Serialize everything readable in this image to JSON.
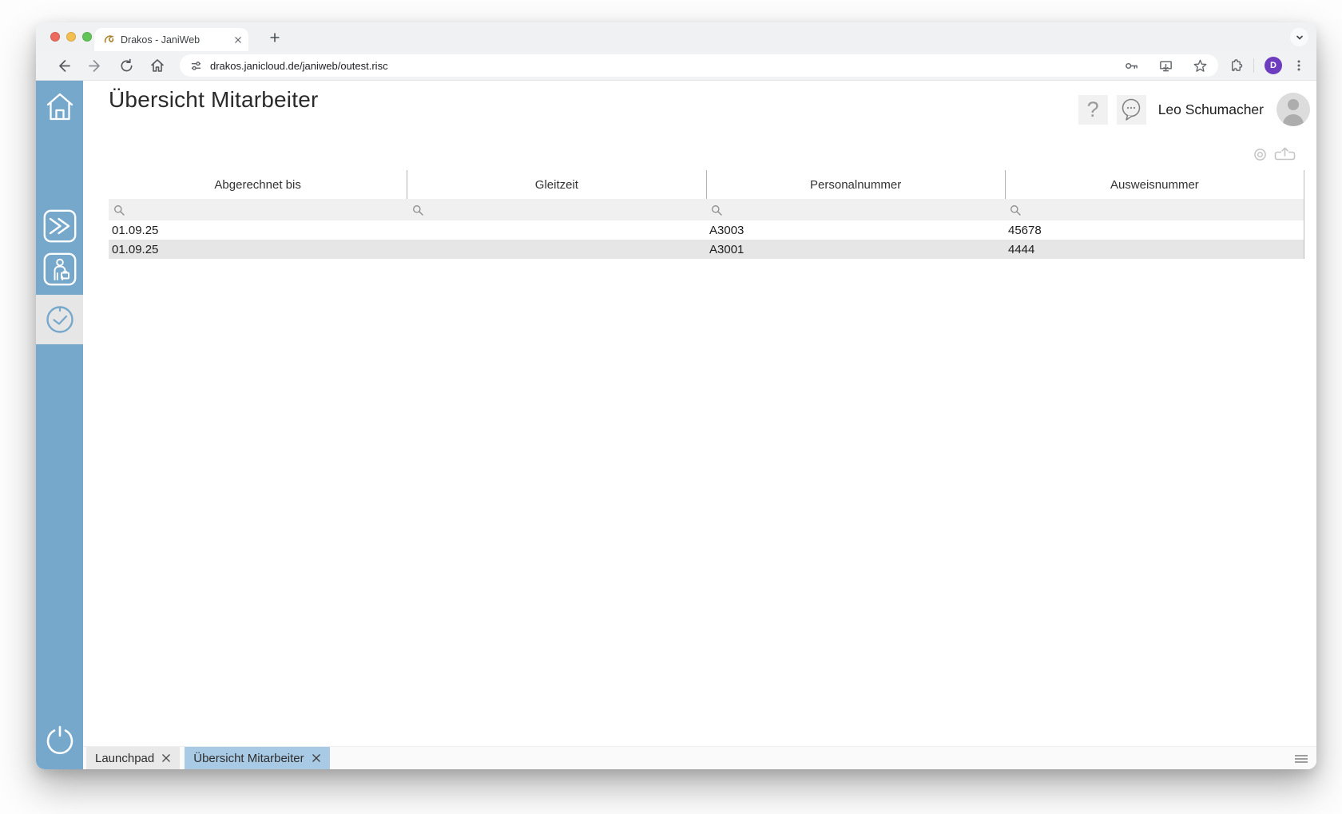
{
  "browser": {
    "tab_title": "Drakos - JaniWeb",
    "url": "drakos.janicloud.de/janiweb/outest.risc",
    "profile_initial": "D"
  },
  "header": {
    "title": "Übersicht Mitarbeiter",
    "help_label": "?",
    "user_name": "Leo Schumacher"
  },
  "table": {
    "columns": [
      "Abgerechnet bis",
      "Gleitzeit",
      "Personalnummer",
      "Ausweisnummer"
    ],
    "rows": [
      [
        "01.09.25",
        "",
        "A3003",
        "45678"
      ],
      [
        "01.09.25",
        "",
        "A3001",
        "4444"
      ]
    ]
  },
  "bottom_tabs": [
    {
      "label": "Launchpad",
      "active": false
    },
    {
      "label": "Übersicht Mitarbeiter",
      "active": true
    }
  ],
  "colors": {
    "sidebar_blue": "#76a8cc",
    "active_bottom_tab_blue": "#a8cae4",
    "filter_row_gray": "#f0f0f0",
    "alt_row_gray": "#e6e6e6",
    "profile_purple": "#6e3cbe",
    "traffic_red": "#ed6a5f",
    "traffic_yellow": "#f5bf4f",
    "traffic_green": "#61c555"
  }
}
